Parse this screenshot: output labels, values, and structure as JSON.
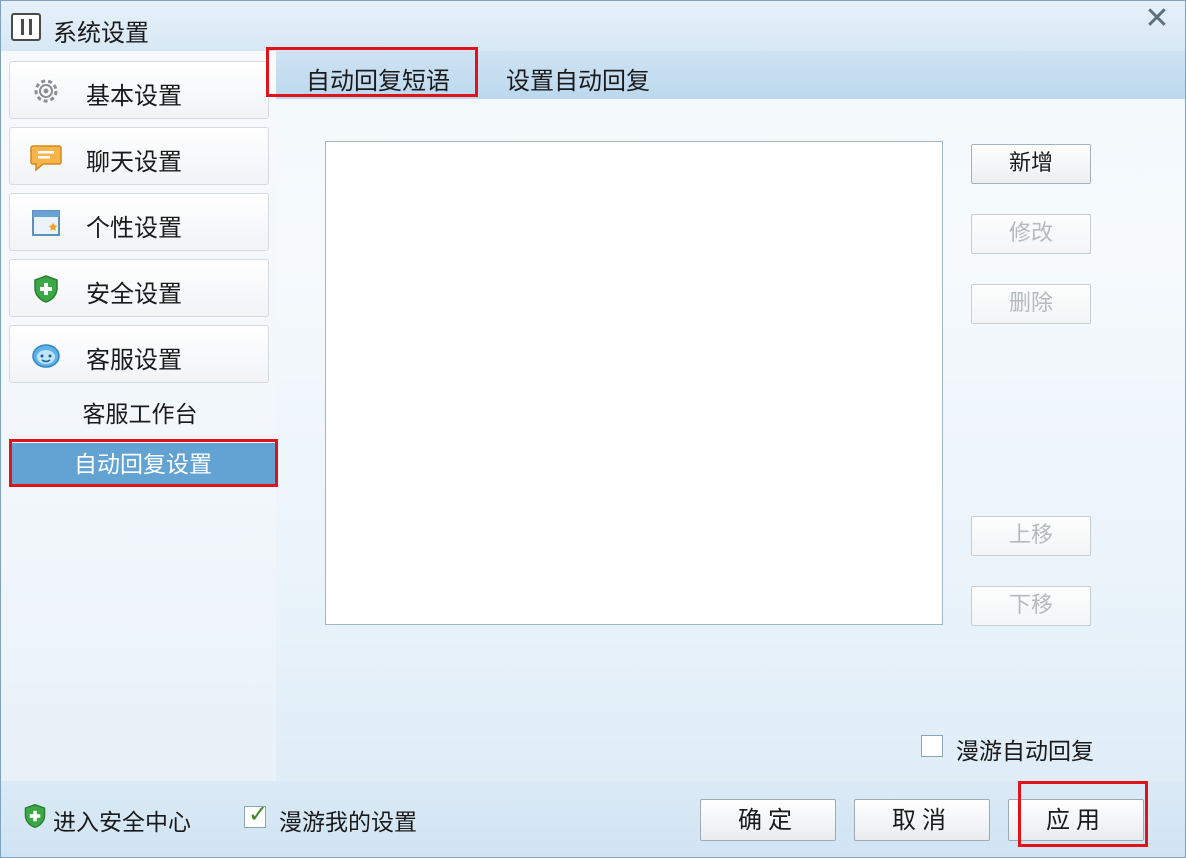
{
  "window": {
    "title": "系统设置",
    "close_symbol": "✕"
  },
  "sidebar": {
    "items": [
      {
        "label": "基本设置",
        "icon": "gear-icon"
      },
      {
        "label": "聊天设置",
        "icon": "chat-bubble-icon"
      },
      {
        "label": "个性设置",
        "icon": "window-icon"
      },
      {
        "label": "安全设置",
        "icon": "shield-icon"
      },
      {
        "label": "客服设置",
        "icon": "service-icon"
      }
    ],
    "subitems": [
      {
        "label": "客服工作台"
      },
      {
        "label": "自动回复设置",
        "active": true
      }
    ]
  },
  "tabs": [
    {
      "label": "自动回复短语",
      "active": true
    },
    {
      "label": "设置自动回复",
      "active": false
    }
  ],
  "buttons": {
    "add": "新增",
    "edit": "修改",
    "delete": "删除",
    "move_up": "上移",
    "move_down": "下移"
  },
  "roaming_auto_reply": {
    "label": "漫游自动回复",
    "checked": false
  },
  "footer": {
    "security_center": "进入安全中心",
    "roaming_settings": {
      "label": "漫游我的设置",
      "checked": true
    },
    "ok": "确定",
    "cancel": "取消",
    "apply": "应用"
  },
  "colors": {
    "highlight": "#e0121a",
    "active_subnav": "#62a3d4",
    "tabbar": "#c5ddf0"
  }
}
